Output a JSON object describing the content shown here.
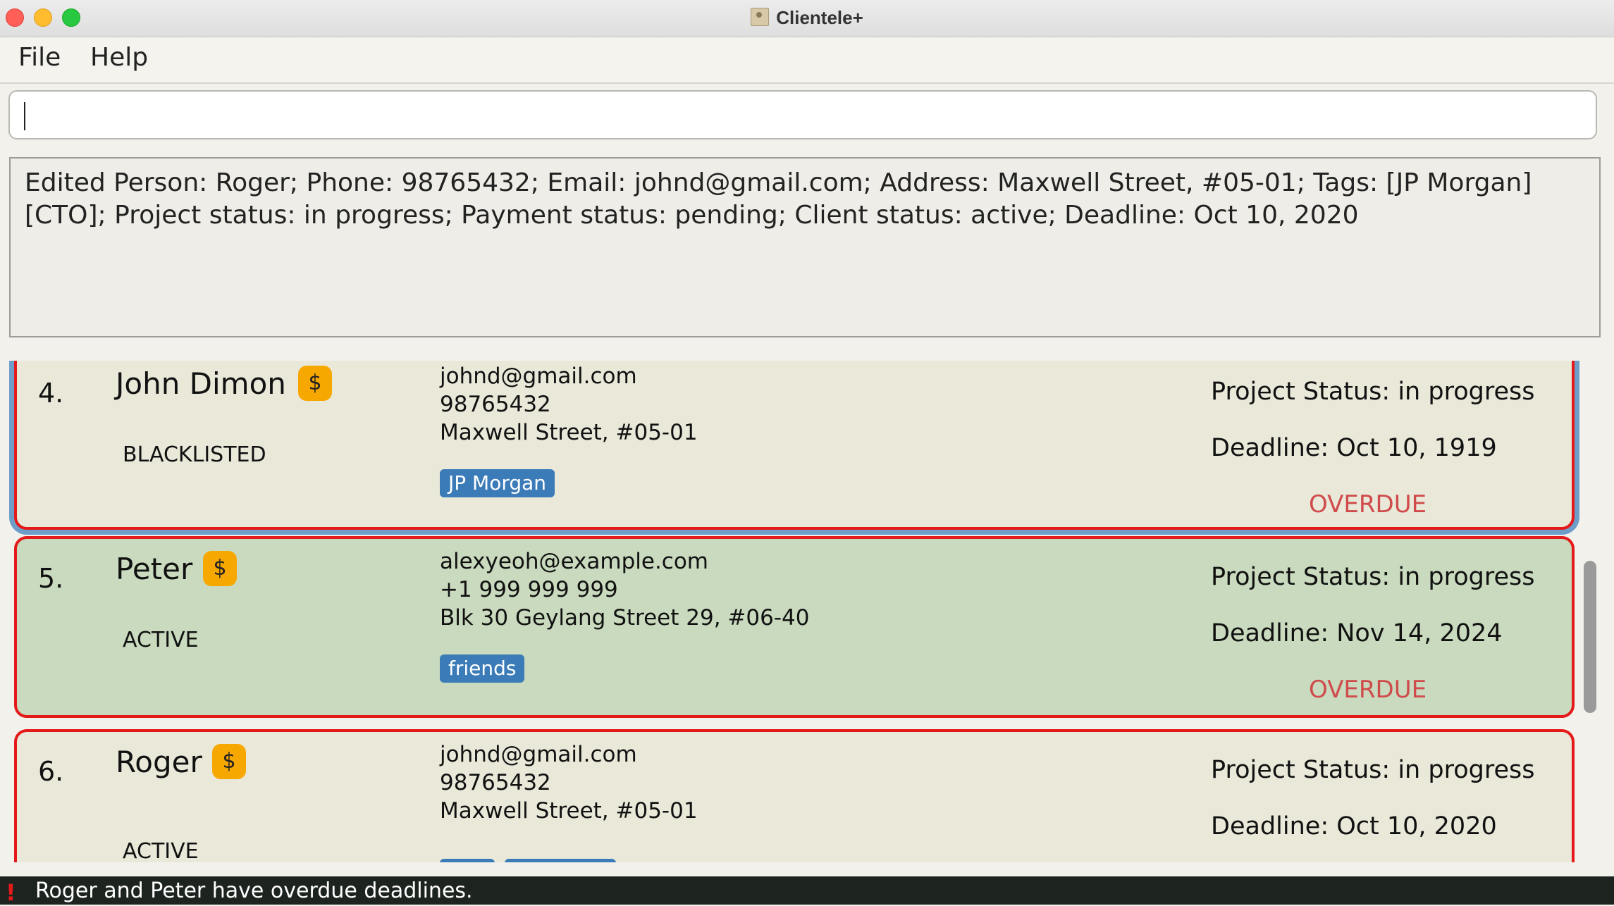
{
  "window": {
    "title": "Clientele+"
  },
  "menu": [
    "File",
    "Help"
  ],
  "command_box": {
    "value": ""
  },
  "result_text": "Edited Person: Roger; Phone: 98765432; Email: johnd@gmail.com; Address: Maxwell Street, #05-01; Tags: [JP Morgan][CTO]; Project status: in progress; Payment status: pending; Client status: active; Deadline: Oct 10, 2020",
  "persons": [
    {
      "index": "4.",
      "name": "John Dimon",
      "payment_icon": "$",
      "client_status": "BLACKLISTED",
      "email": "johnd@gmail.com",
      "phone": "98765432",
      "address": "Maxwell Street, #05-01",
      "tags": [
        "JP Morgan"
      ],
      "project_status": "Project Status: in progress",
      "deadline": "Deadline: Oct 10, 1919",
      "overdue": "OVERDUE",
      "background": "#e9e8d9",
      "selected": true
    },
    {
      "index": "5.",
      "name": "Peter",
      "payment_icon": "$",
      "client_status": "ACTIVE",
      "email": "alexyeoh@example.com",
      "phone": "+1 999 999 999",
      "address": "Blk 30 Geylang Street 29, #06-40",
      "tags": [
        "friends"
      ],
      "project_status": "Project Status: in progress",
      "deadline": "Deadline: Nov 14, 2024",
      "overdue": "OVERDUE",
      "background": "#c9dabe",
      "selected": false
    },
    {
      "index": "6.",
      "name": "Roger",
      "payment_icon": "$",
      "client_status": "ACTIVE",
      "email": "johnd@gmail.com",
      "phone": "98765432",
      "address": "Maxwell Street, #05-01",
      "tags": [
        "",
        ""
      ],
      "project_status": "Project Status: in progress",
      "deadline": "Deadline: Oct 10, 2020",
      "overdue": "",
      "background": "#e9e8d9",
      "selected": false
    }
  ],
  "status_bar": {
    "icon": "!",
    "text": "Roger and Peter have overdue deadlines."
  },
  "colors": {
    "border_overdue": "#e41a1a",
    "tag": "#3a7bb8",
    "payment_badge": "#f7a800",
    "overdue_text": "#d04b4b",
    "selection": "#6d9dc8"
  }
}
